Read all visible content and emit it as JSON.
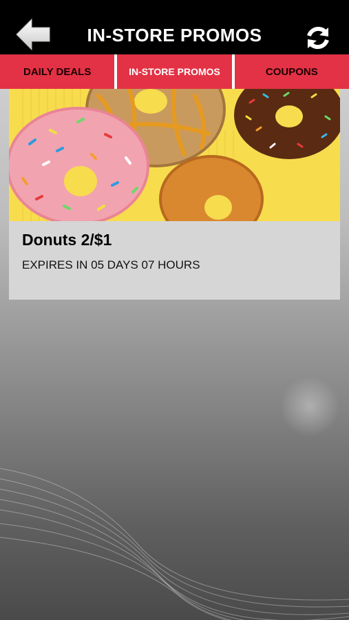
{
  "header": {
    "title": "IN-STORE PROMOS",
    "back_icon": "back-arrow-icon",
    "refresh_icon": "refresh-icon"
  },
  "tabs": [
    {
      "label": "DAILY DEALS",
      "active": false
    },
    {
      "label": "IN-STORE PROMOS",
      "active": true
    },
    {
      "label": "COUPONS",
      "active": false
    }
  ],
  "promos": [
    {
      "image": "donuts-photo",
      "title": "Donuts 2/$1",
      "expiry": "EXPIRES IN 05 DAYS 07 HOURS"
    }
  ],
  "colors": {
    "header_bg": "#000000",
    "tab_bg": "#e33245",
    "card_bg": "#d6d6d6",
    "image_bg": "#f7dc4e"
  }
}
